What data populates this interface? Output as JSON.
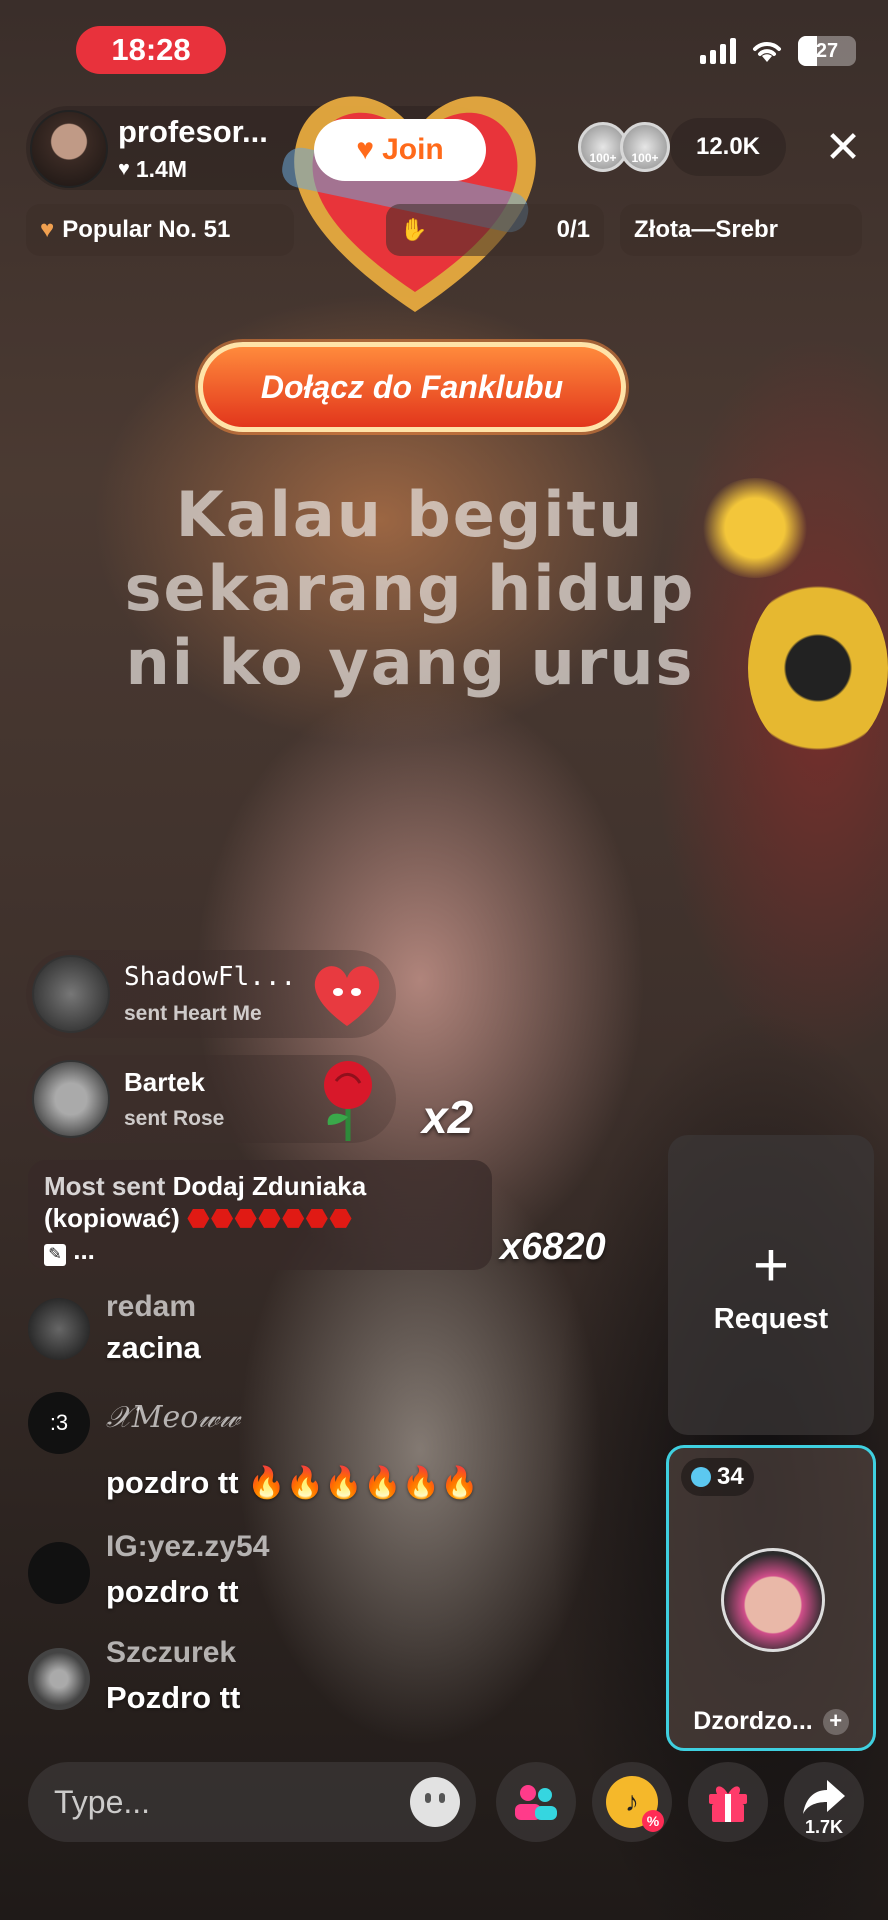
{
  "status": {
    "time": "18:28",
    "battery": "27"
  },
  "host": {
    "name": "profesor...",
    "likes": "1.4M",
    "join_label": "Join"
  },
  "viewers": {
    "coin_labels": [
      "100+",
      "100+"
    ],
    "count": "12.0K"
  },
  "info_pills": {
    "popular": "Popular No. 51",
    "match": "0/1",
    "ranking": "Złota—Srebr"
  },
  "fanclub_button": "Dołącz do Fanklubu",
  "lyrics": [
    "Kalau begitu",
    "sekarang hidup",
    "ni ko yang urus"
  ],
  "gifts": [
    {
      "user": "ShadowFl...",
      "action": "sent Heart Me",
      "icon": "heart-me-icon"
    },
    {
      "user": "Bartek",
      "action": "sent Rose",
      "icon": "rose-icon",
      "combo": "x2"
    }
  ],
  "most_sent": {
    "prefix": "Most sent",
    "name": "Dodaj Zduniaka",
    "line2": "(kopiować)",
    "tail": "...",
    "combo": "x6820"
  },
  "comments": [
    {
      "user": "redam",
      "text": "zacina",
      "avatar": ""
    },
    {
      "user": "𝒳𝑀𝑒𝑜𝓌𝓌",
      "text": "pozdro tt 🔥🔥🔥🔥🔥🔥",
      "avatar": ":3"
    },
    {
      "user": "IG:yez.zy54",
      "text": "pozdro tt",
      "avatar": ""
    },
    {
      "user": "Szczurek",
      "text": "Pozdro tt",
      "avatar": ""
    }
  ],
  "request": {
    "label": "Request"
  },
  "guest": {
    "badge": "34",
    "name": "Dzordzo..."
  },
  "bottom": {
    "placeholder": "Type...",
    "share_count": "1.7K"
  },
  "colors": {
    "accent_red": "#e8323c",
    "join_orange": "#ff6a1a",
    "guest_border": "#3fd0e0",
    "fanclub": "#e2361c"
  }
}
